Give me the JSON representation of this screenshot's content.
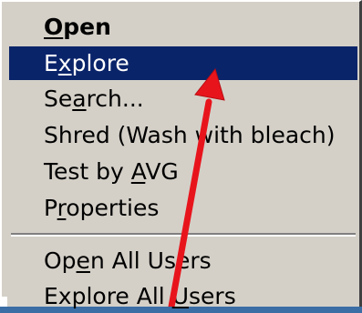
{
  "menu": {
    "items": [
      {
        "pre": "",
        "acc": "O",
        "post": "pen",
        "bold": true,
        "selected": false
      },
      {
        "pre": "E",
        "acc": "x",
        "post": "plore",
        "bold": false,
        "selected": true
      },
      {
        "pre": "Se",
        "acc": "a",
        "post": "rch...",
        "bold": false,
        "selected": false
      },
      {
        "pre": "Shred (Wash with bleach)",
        "acc": "",
        "post": "",
        "bold": false,
        "selected": false
      },
      {
        "pre": "Test by ",
        "acc": "A",
        "post": "VG",
        "bold": false,
        "selected": false
      },
      {
        "pre": "P",
        "acc": "r",
        "post": "operties",
        "bold": false,
        "selected": false
      },
      {
        "pre": "Op",
        "acc": "e",
        "post": "n All Users",
        "bold": false,
        "selected": false
      },
      {
        "pre": "Explore All ",
        "acc": "U",
        "post": "sers",
        "bold": false,
        "selected": false
      }
    ]
  },
  "colors": {
    "menu_bg": "#d4d0c8",
    "highlight": "#0a246a",
    "arrow": "#e8141c"
  },
  "annotation": {
    "type": "red-arrow",
    "points_to": "Explore"
  }
}
